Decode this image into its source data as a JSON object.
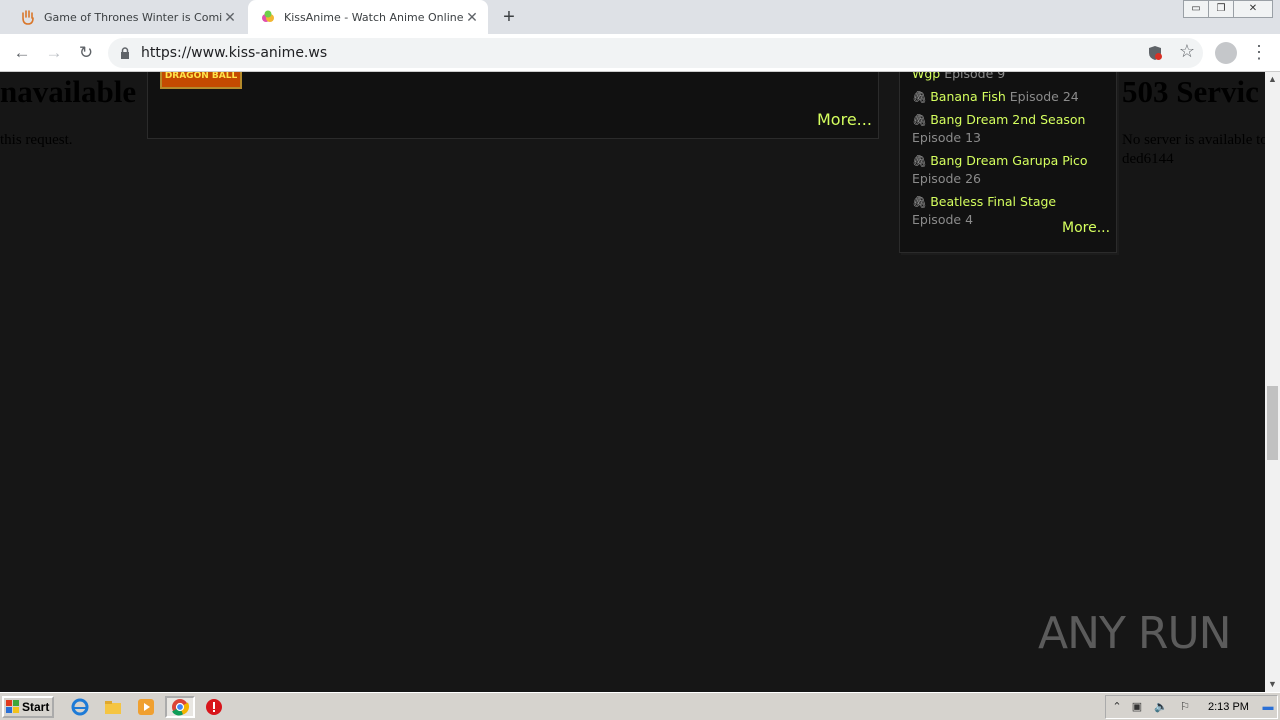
{
  "browser": {
    "tabs": [
      {
        "title": "Game of Thrones Winter is Coming",
        "active": false
      },
      {
        "title": "KissAnime - Watch Anime Online English",
        "active": true
      }
    ],
    "new_tab_label": "+",
    "url": "https://www.kiss-anime.ws",
    "window_controls": {
      "minimize": "▭",
      "restore": "❐",
      "close": "✕"
    }
  },
  "page": {
    "error_left": {
      "heading": "navailable",
      "text": "this request."
    },
    "error_right": {
      "heading": "503 Servic",
      "line1": "No server is available to",
      "line2": "ded6144"
    },
    "left_panel": {
      "thumb_label": "DRAGON BALL",
      "more_label": "More..."
    },
    "right_panel": {
      "items": [
        {
          "name": "Wgp",
          "episode": "Episode 9"
        },
        {
          "name": "Banana Fish",
          "episode": "Episode 24"
        },
        {
          "name": "Bang Dream 2nd Season",
          "episode": "Episode 13"
        },
        {
          "name": "Bang Dream Garupa Pico",
          "episode": "Episode 26"
        },
        {
          "name": "Beatless Final Stage",
          "episode": "Episode 4"
        }
      ],
      "more_label": "More..."
    },
    "watermark": "ANY RUN"
  },
  "taskbar": {
    "start_label": "Start",
    "clock": "2:13 PM"
  },
  "colors": {
    "link": "#d5ff5f",
    "page_bg": "#161616",
    "panel_bg": "#111111"
  }
}
